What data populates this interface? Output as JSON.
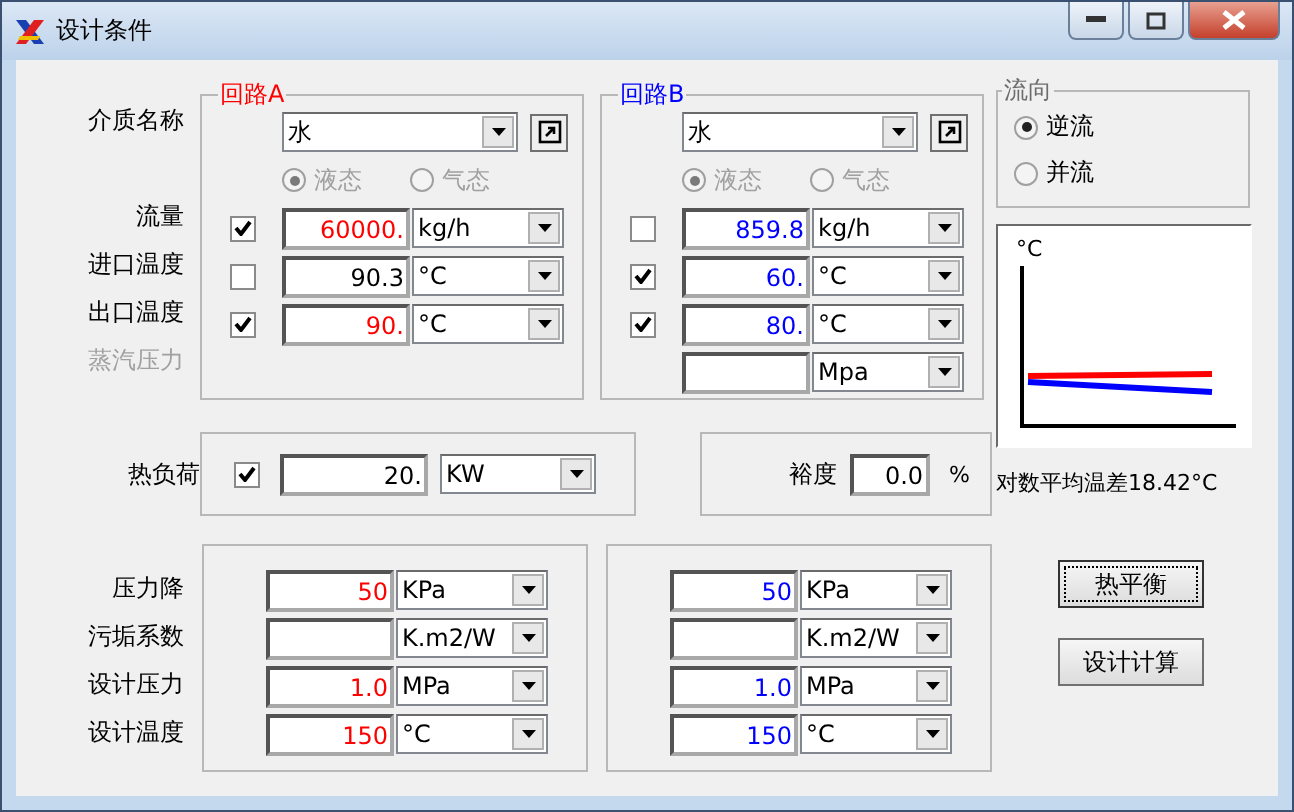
{
  "window": {
    "title": "设计条件"
  },
  "labels": [
    {
      "text": "介质名称",
      "disabled": false
    },
    {
      "text": "流量",
      "disabled": false
    },
    {
      "text": "进口温度",
      "disabled": false
    },
    {
      "text": "出口温度",
      "disabled": false
    },
    {
      "text": "蒸汽压力",
      "disabled": true
    }
  ],
  "circuits": [
    {
      "title": "回路A",
      "color": "#ff0000",
      "medium": "水",
      "phases": [
        {
          "label": "液态",
          "selected": true,
          "disabled": true
        },
        {
          "label": "气态",
          "selected": false,
          "disabled": true
        }
      ],
      "rows": [
        {
          "kind": "checked",
          "checked": true,
          "value": "60000.",
          "color": "#ff0000",
          "unit": "kg/h"
        },
        {
          "kind": "checked",
          "checked": false,
          "value": "90.3",
          "color": "#000000",
          "unit": "°C"
        },
        {
          "kind": "checked",
          "checked": true,
          "value": "90.",
          "color": "#ff0000",
          "unit": "°C"
        }
      ]
    },
    {
      "title": "回路B",
      "color": "#0000ff",
      "medium": "水",
      "phases": [
        {
          "label": "液态",
          "selected": true,
          "disabled": true
        },
        {
          "label": "气态",
          "selected": false,
          "disabled": true
        }
      ],
      "rows": [
        {
          "kind": "checked",
          "checked": false,
          "value": "859.8",
          "color": "#0000ff",
          "unit": "kg/h"
        },
        {
          "kind": "checked",
          "checked": true,
          "value": "60.",
          "color": "#0000ff",
          "unit": "°C"
        },
        {
          "kind": "checked",
          "checked": true,
          "value": "80.",
          "color": "#0000ff",
          "unit": "°C"
        },
        {
          "kind": "plain",
          "unit": "Mpa"
        }
      ]
    }
  ],
  "flow_direction": {
    "title": "流向",
    "options": [
      {
        "label": "逆流",
        "selected": true
      },
      {
        "label": "并流",
        "selected": false
      }
    ]
  },
  "chart": {
    "axis_label": "°C",
    "caption": "对数平均温差18.42°C"
  },
  "heat_load": {
    "label": "热负荷",
    "checked": true,
    "value": "20.",
    "unit": "KW"
  },
  "margin": {
    "label": "裕度",
    "value": "0.0",
    "unit": "%"
  },
  "design": {
    "labels": [
      "压力降",
      "污垢系数",
      "设计压力",
      "设计温度"
    ],
    "columns": [
      {
        "color": "#ff0000",
        "rows": [
          {
            "value": "50",
            "unit": "KPa"
          },
          {
            "unit": "K.m2/W"
          },
          {
            "value": "1.0",
            "unit": "MPa"
          },
          {
            "value": "150",
            "unit": "°C"
          }
        ]
      },
      {
        "color": "#0000ff",
        "rows": [
          {
            "value": "50",
            "unit": "KPa"
          },
          {
            "unit": "K.m2/W"
          },
          {
            "value": "1.0",
            "unit": "MPa"
          },
          {
            "value": "150",
            "unit": "°C"
          }
        ]
      }
    ]
  },
  "buttons": [
    {
      "label": "热平衡",
      "focused": true
    },
    {
      "label": "设计计算",
      "focused": false
    }
  ]
}
